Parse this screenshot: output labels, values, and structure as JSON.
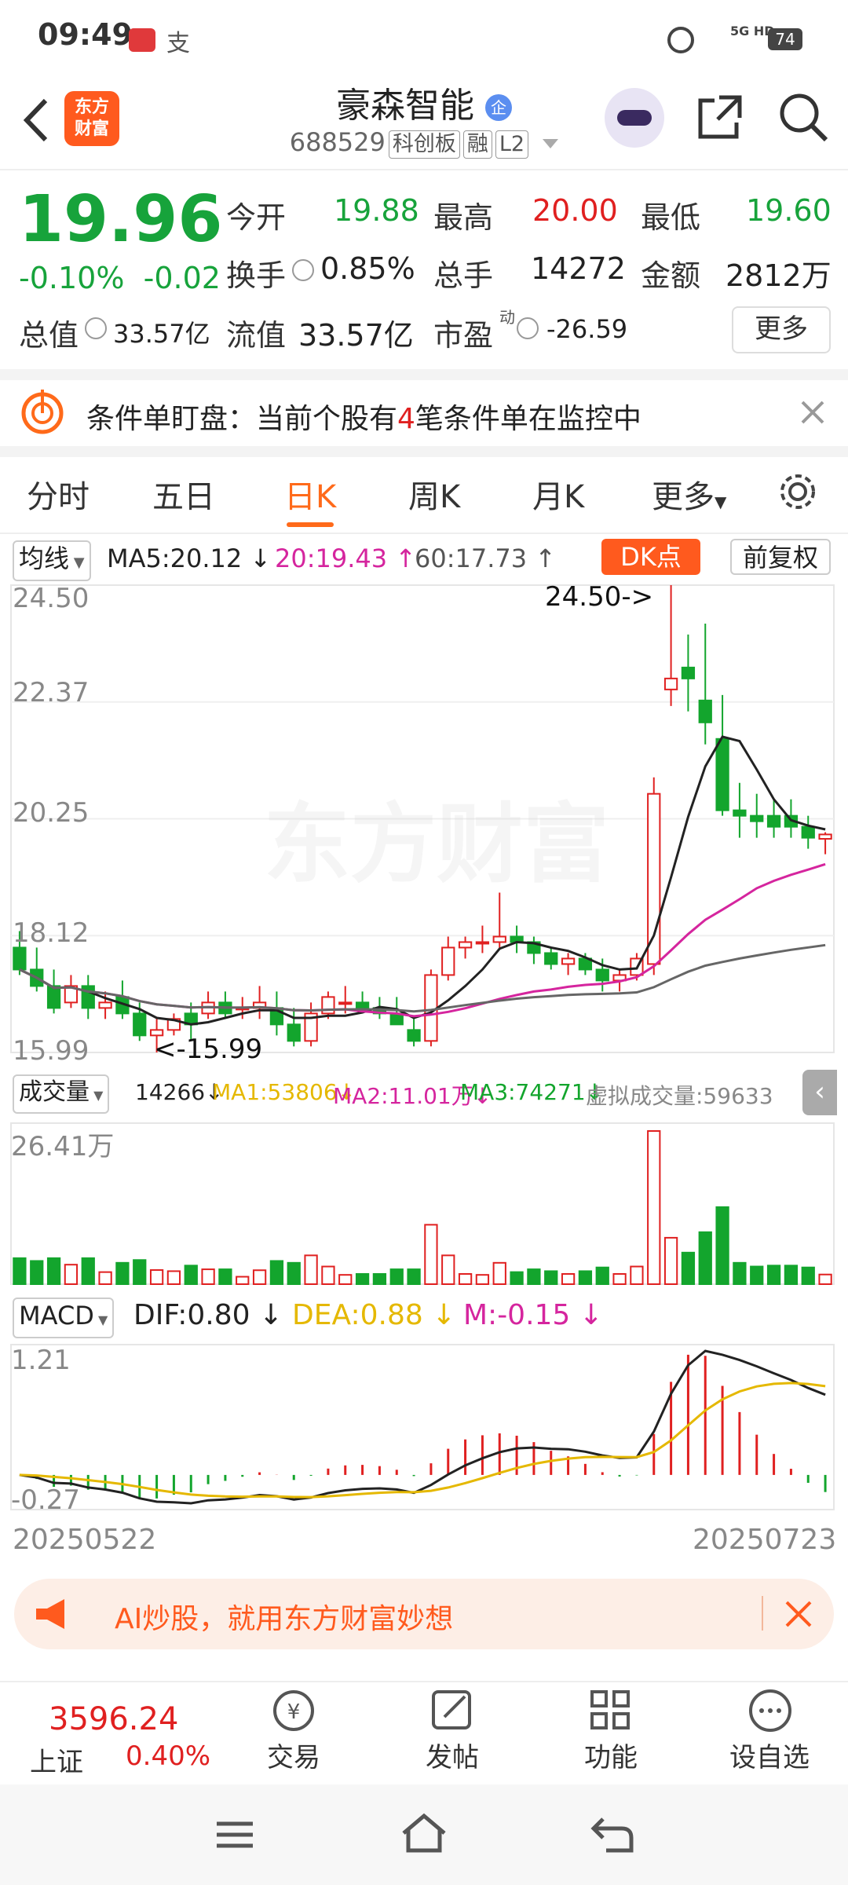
{
  "status_bar": {
    "time": "09:49",
    "network": "5G HD",
    "battery": "74"
  },
  "header": {
    "back_label": "‹",
    "logo_line1": "东方",
    "logo_line2": "财富",
    "stock_name": "豪森智能",
    "stock_badge": "企",
    "stock_code": "688529",
    "tags": [
      "科创板",
      "融",
      "L2"
    ]
  },
  "quote": {
    "price": "19.96",
    "change_pct": "-0.10%",
    "change": "-0.02",
    "open_label": "今开",
    "open": "19.88",
    "high_label": "最高",
    "high": "20.00",
    "low_label": "最低",
    "low": "19.60",
    "turnover_label": "换手",
    "turnover": "0.85%",
    "volume_label": "总手",
    "volume": "14272",
    "amount_label": "金额",
    "amount": "2812万",
    "mktcap_label": "总值",
    "mktcap": "33.57亿",
    "float_label": "流值",
    "float_cap": "33.57亿",
    "pe_label": "市盈",
    "pe_sup": "动",
    "pe": "-26.59",
    "more_label": "更多"
  },
  "notice": {
    "prefix": "条件单盯盘：当前个股有",
    "count": "4",
    "suffix": "笔条件单在监控中"
  },
  "tabs": [
    "分时",
    "五日",
    "日K",
    "周K",
    "月K",
    "更多"
  ],
  "kline": {
    "indicator_select": "均线",
    "ma5": "MA5:20.12 ↓",
    "ma20": "20:19.43 ↑",
    "ma60": "60:17.73 ↑",
    "dk_label": "DK点",
    "fq_label": "前复权",
    "y_labels": [
      "24.50",
      "22.37",
      "20.25",
      "18.12",
      "15.99"
    ],
    "max_annot": "24.50->",
    "min_annot": "<-15.99",
    "watermark": "东方财富",
    "colors": {
      "up": "#e02020",
      "down": "#13a52d",
      "ma5": "#222222",
      "ma20": "#d5259e",
      "ma60": "#666666"
    }
  },
  "volume": {
    "select": "成交量",
    "vol": "14266↓",
    "ma1": "MA1:53806↓",
    "ma2": "MA2:11.01万↓",
    "ma3": "MA3:74271↓",
    "virtual": "虚拟成交量:59633",
    "ymax": "26.41万"
  },
  "macd": {
    "select": "MACD",
    "dif": "DIF:0.80 ↓",
    "dea": "DEA:0.88 ↓",
    "m": "M:-0.15 ↓",
    "ymax": "1.21",
    "ymin": "-0.27"
  },
  "dates": {
    "start": "20250522",
    "end": "20250723"
  },
  "ad": {
    "text": "AI炒股，就用东方财富妙想"
  },
  "bottom_nav": {
    "index_value": "3596.24",
    "index_name": "上证",
    "index_pct": "0.40%",
    "items": [
      "交易",
      "发帖",
      "功能",
      "设自选"
    ]
  },
  "chart_data": {
    "type": "candlestick",
    "x_start": "20250522",
    "x_end": "20250723",
    "ylim": [
      15.99,
      24.5
    ],
    "candles": [
      {
        "o": 17.9,
        "h": 18.2,
        "l": 17.4,
        "c": 17.5
      },
      {
        "o": 17.5,
        "h": 17.9,
        "l": 17.1,
        "c": 17.2
      },
      {
        "o": 17.2,
        "h": 17.5,
        "l": 16.7,
        "c": 16.8
      },
      {
        "o": 16.9,
        "h": 17.4,
        "l": 16.8,
        "c": 17.2
      },
      {
        "o": 17.2,
        "h": 17.4,
        "l": 16.6,
        "c": 16.8
      },
      {
        "o": 16.8,
        "h": 17.1,
        "l": 16.6,
        "c": 16.9
      },
      {
        "o": 17.0,
        "h": 17.3,
        "l": 16.6,
        "c": 16.7
      },
      {
        "o": 16.7,
        "h": 16.9,
        "l": 16.2,
        "c": 16.3
      },
      {
        "o": 16.3,
        "h": 16.6,
        "l": 15.99,
        "c": 16.4
      },
      {
        "o": 16.4,
        "h": 16.7,
        "l": 16.3,
        "c": 16.6
      },
      {
        "o": 16.7,
        "h": 16.9,
        "l": 16.2,
        "c": 16.5
      },
      {
        "o": 16.7,
        "h": 17.1,
        "l": 16.6,
        "c": 16.9
      },
      {
        "o": 16.9,
        "h": 17.1,
        "l": 16.6,
        "c": 16.7
      },
      {
        "o": 16.8,
        "h": 17.0,
        "l": 16.6,
        "c": 16.8
      },
      {
        "o": 16.8,
        "h": 17.2,
        "l": 16.6,
        "c": 16.9
      },
      {
        "o": 16.8,
        "h": 17.1,
        "l": 16.3,
        "c": 16.5
      },
      {
        "o": 16.5,
        "h": 16.8,
        "l": 16.1,
        "c": 16.2
      },
      {
        "o": 16.2,
        "h": 16.9,
        "l": 16.1,
        "c": 16.7
      },
      {
        "o": 16.7,
        "h": 17.1,
        "l": 16.6,
        "c": 17.0
      },
      {
        "o": 16.9,
        "h": 17.2,
        "l": 16.7,
        "c": 16.9
      },
      {
        "o": 16.9,
        "h": 17.1,
        "l": 16.7,
        "c": 16.8
      },
      {
        "o": 16.8,
        "h": 17.0,
        "l": 16.6,
        "c": 16.7
      },
      {
        "o": 16.7,
        "h": 17.0,
        "l": 16.5,
        "c": 16.5
      },
      {
        "o": 16.4,
        "h": 16.6,
        "l": 16.1,
        "c": 16.2
      },
      {
        "o": 16.2,
        "h": 17.5,
        "l": 16.1,
        "c": 17.4
      },
      {
        "o": 17.4,
        "h": 18.1,
        "l": 17.3,
        "c": 17.9
      },
      {
        "o": 17.9,
        "h": 18.1,
        "l": 17.7,
        "c": 18.0
      },
      {
        "o": 18.0,
        "h": 18.3,
        "l": 17.8,
        "c": 18.0
      },
      {
        "o": 18.0,
        "h": 18.9,
        "l": 17.9,
        "c": 18.1
      },
      {
        "o": 18.1,
        "h": 18.3,
        "l": 17.8,
        "c": 18.0
      },
      {
        "o": 18.0,
        "h": 18.1,
        "l": 17.6,
        "c": 17.8
      },
      {
        "o": 17.8,
        "h": 17.9,
        "l": 17.5,
        "c": 17.6
      },
      {
        "o": 17.6,
        "h": 17.8,
        "l": 17.4,
        "c": 17.7
      },
      {
        "o": 17.7,
        "h": 17.8,
        "l": 17.4,
        "c": 17.5
      },
      {
        "o": 17.5,
        "h": 17.7,
        "l": 17.1,
        "c": 17.3
      },
      {
        "o": 17.3,
        "h": 17.5,
        "l": 17.1,
        "c": 17.4
      },
      {
        "o": 17.4,
        "h": 17.8,
        "l": 17.3,
        "c": 17.7
      },
      {
        "o": 17.6,
        "h": 21.0,
        "l": 17.4,
        "c": 20.7
      },
      {
        "o": 22.6,
        "h": 24.5,
        "l": 22.3,
        "c": 22.8
      },
      {
        "o": 23.0,
        "h": 23.6,
        "l": 22.2,
        "c": 22.8
      },
      {
        "o": 22.4,
        "h": 23.8,
        "l": 21.6,
        "c": 22.0
      },
      {
        "o": 21.7,
        "h": 22.5,
        "l": 20.3,
        "c": 20.4
      },
      {
        "o": 20.4,
        "h": 20.9,
        "l": 19.9,
        "c": 20.3
      },
      {
        "o": 20.3,
        "h": 20.7,
        "l": 19.9,
        "c": 20.2
      },
      {
        "o": 20.3,
        "h": 20.6,
        "l": 19.9,
        "c": 20.1
      },
      {
        "o": 20.3,
        "h": 20.6,
        "l": 19.9,
        "c": 20.1
      },
      {
        "o": 20.1,
        "h": 20.3,
        "l": 19.7,
        "c": 19.9
      },
      {
        "o": 19.88,
        "h": 20.0,
        "l": 19.6,
        "c": 19.96
      }
    ]
  }
}
